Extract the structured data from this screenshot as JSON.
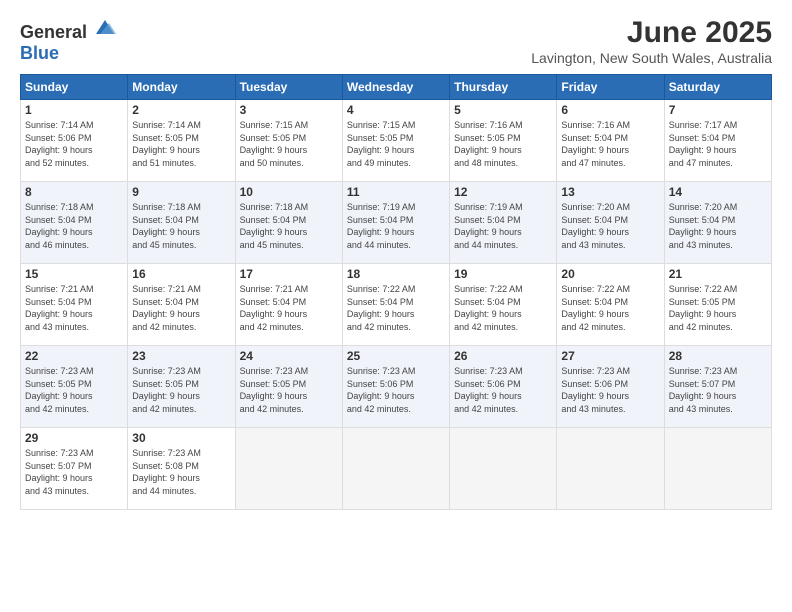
{
  "header": {
    "logo_general": "General",
    "logo_blue": "Blue",
    "month": "June 2025",
    "location": "Lavington, New South Wales, Australia"
  },
  "weekdays": [
    "Sunday",
    "Monday",
    "Tuesday",
    "Wednesday",
    "Thursday",
    "Friday",
    "Saturday"
  ],
  "weeks": [
    [
      {
        "day": "1",
        "sunrise": "7:14 AM",
        "sunset": "5:06 PM",
        "daylight": "9 hours and 52 minutes."
      },
      {
        "day": "2",
        "sunrise": "7:14 AM",
        "sunset": "5:05 PM",
        "daylight": "9 hours and 51 minutes."
      },
      {
        "day": "3",
        "sunrise": "7:15 AM",
        "sunset": "5:05 PM",
        "daylight": "9 hours and 50 minutes."
      },
      {
        "day": "4",
        "sunrise": "7:15 AM",
        "sunset": "5:05 PM",
        "daylight": "9 hours and 49 minutes."
      },
      {
        "day": "5",
        "sunrise": "7:16 AM",
        "sunset": "5:05 PM",
        "daylight": "9 hours and 48 minutes."
      },
      {
        "day": "6",
        "sunrise": "7:16 AM",
        "sunset": "5:04 PM",
        "daylight": "9 hours and 47 minutes."
      },
      {
        "day": "7",
        "sunrise": "7:17 AM",
        "sunset": "5:04 PM",
        "daylight": "9 hours and 47 minutes."
      }
    ],
    [
      {
        "day": "8",
        "sunrise": "7:18 AM",
        "sunset": "5:04 PM",
        "daylight": "9 hours and 46 minutes."
      },
      {
        "day": "9",
        "sunrise": "7:18 AM",
        "sunset": "5:04 PM",
        "daylight": "9 hours and 45 minutes."
      },
      {
        "day": "10",
        "sunrise": "7:18 AM",
        "sunset": "5:04 PM",
        "daylight": "9 hours and 45 minutes."
      },
      {
        "day": "11",
        "sunrise": "7:19 AM",
        "sunset": "5:04 PM",
        "daylight": "9 hours and 44 minutes."
      },
      {
        "day": "12",
        "sunrise": "7:19 AM",
        "sunset": "5:04 PM",
        "daylight": "9 hours and 44 minutes."
      },
      {
        "day": "13",
        "sunrise": "7:20 AM",
        "sunset": "5:04 PM",
        "daylight": "9 hours and 43 minutes."
      },
      {
        "day": "14",
        "sunrise": "7:20 AM",
        "sunset": "5:04 PM",
        "daylight": "9 hours and 43 minutes."
      }
    ],
    [
      {
        "day": "15",
        "sunrise": "7:21 AM",
        "sunset": "5:04 PM",
        "daylight": "9 hours and 43 minutes."
      },
      {
        "day": "16",
        "sunrise": "7:21 AM",
        "sunset": "5:04 PM",
        "daylight": "9 hours and 42 minutes."
      },
      {
        "day": "17",
        "sunrise": "7:21 AM",
        "sunset": "5:04 PM",
        "daylight": "9 hours and 42 minutes."
      },
      {
        "day": "18",
        "sunrise": "7:22 AM",
        "sunset": "5:04 PM",
        "daylight": "9 hours and 42 minutes."
      },
      {
        "day": "19",
        "sunrise": "7:22 AM",
        "sunset": "5:04 PM",
        "daylight": "9 hours and 42 minutes."
      },
      {
        "day": "20",
        "sunrise": "7:22 AM",
        "sunset": "5:04 PM",
        "daylight": "9 hours and 42 minutes."
      },
      {
        "day": "21",
        "sunrise": "7:22 AM",
        "sunset": "5:05 PM",
        "daylight": "9 hours and 42 minutes."
      }
    ],
    [
      {
        "day": "22",
        "sunrise": "7:23 AM",
        "sunset": "5:05 PM",
        "daylight": "9 hours and 42 minutes."
      },
      {
        "day": "23",
        "sunrise": "7:23 AM",
        "sunset": "5:05 PM",
        "daylight": "9 hours and 42 minutes."
      },
      {
        "day": "24",
        "sunrise": "7:23 AM",
        "sunset": "5:05 PM",
        "daylight": "9 hours and 42 minutes."
      },
      {
        "day": "25",
        "sunrise": "7:23 AM",
        "sunset": "5:06 PM",
        "daylight": "9 hours and 42 minutes."
      },
      {
        "day": "26",
        "sunrise": "7:23 AM",
        "sunset": "5:06 PM",
        "daylight": "9 hours and 42 minutes."
      },
      {
        "day": "27",
        "sunrise": "7:23 AM",
        "sunset": "5:06 PM",
        "daylight": "9 hours and 43 minutes."
      },
      {
        "day": "28",
        "sunrise": "7:23 AM",
        "sunset": "5:07 PM",
        "daylight": "9 hours and 43 minutes."
      }
    ],
    [
      {
        "day": "29",
        "sunrise": "7:23 AM",
        "sunset": "5:07 PM",
        "daylight": "9 hours and 43 minutes."
      },
      {
        "day": "30",
        "sunrise": "7:23 AM",
        "sunset": "5:08 PM",
        "daylight": "9 hours and 44 minutes."
      },
      null,
      null,
      null,
      null,
      null
    ]
  ],
  "labels": {
    "sunrise": "Sunrise:",
    "sunset": "Sunset:",
    "daylight": "Daylight:"
  }
}
